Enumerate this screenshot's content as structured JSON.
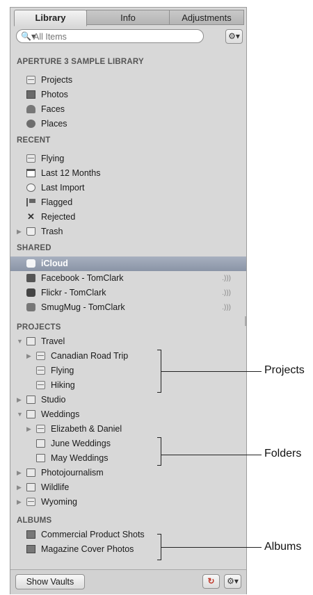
{
  "tabs": [
    "Library",
    "Info",
    "Adjustments"
  ],
  "search": {
    "placeholder": "All Items"
  },
  "sections": {
    "library": "APERTURE 3 SAMPLE LIBRARY",
    "recent": "RECENT",
    "shared": "SHARED",
    "projects": "PROJECTS",
    "albums": "ALBUMS"
  },
  "library_items": [
    "Projects",
    "Photos",
    "Faces",
    "Places"
  ],
  "recent_items": [
    "Flying",
    "Last 12 Months",
    "Last Import",
    "Flagged",
    "Rejected",
    "Trash"
  ],
  "shared_items": [
    "iCloud",
    "Facebook - TomClark",
    "Flickr - TomClark",
    "SmugMug - TomClark"
  ],
  "project_items": [
    "Travel",
    "Canadian Road Trip",
    "Flying",
    "Hiking",
    "Studio",
    "Weddings",
    "Elizabeth & Daniel",
    "June Weddings",
    "May Weddings",
    "Photojournalism",
    "Wildlife",
    "Wyoming"
  ],
  "album_items": [
    "Commercial Product Shots",
    "Magazine Cover Photos"
  ],
  "bottom": {
    "show_vaults": "Show Vaults"
  },
  "callouts": [
    "Projects",
    "Folders",
    "Albums"
  ],
  "icons": {
    "search": "search-icon",
    "gear": "gear-icon",
    "sync": "sync-icon"
  },
  "colors": {
    "panel": "#d8d8d8",
    "selection": "#8a94a6"
  }
}
